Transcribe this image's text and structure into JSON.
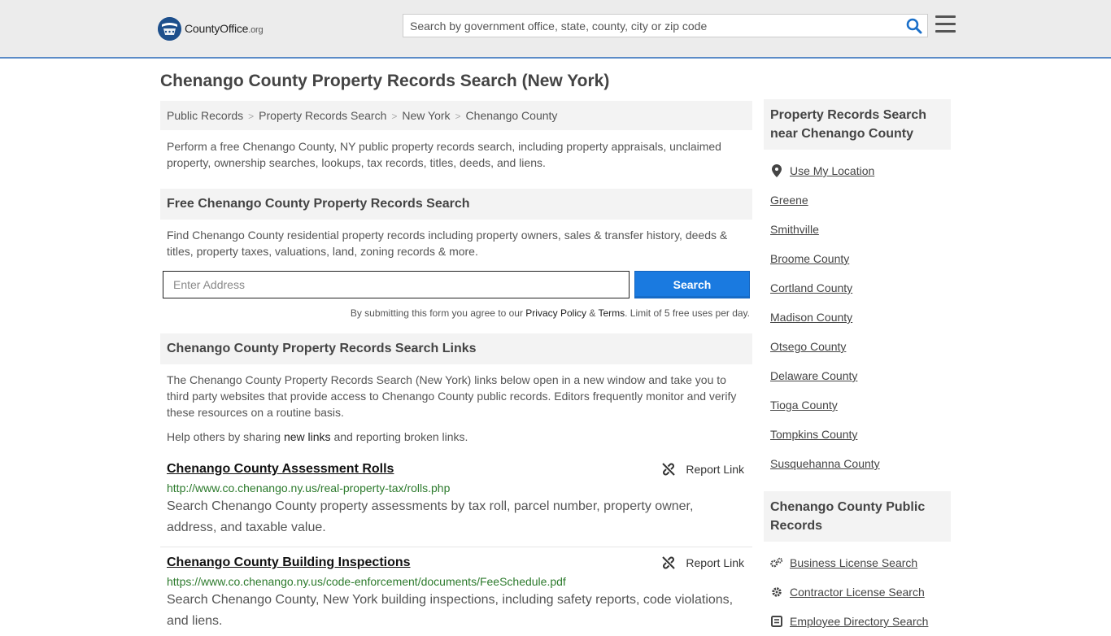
{
  "header": {
    "logo_main": "CountyOffice",
    "logo_org": ".org",
    "search_placeholder": "Search by government office, state, county, city or zip code"
  },
  "page_title": "Chenango County Property Records Search (New York)",
  "breadcrumbs": [
    "Public Records",
    "Property Records Search",
    "New York",
    "Chenango County"
  ],
  "intro": "Perform a free Chenango County, NY public property records search, including property appraisals, unclaimed property, ownership searches, lookups, tax records, titles, deeds, and liens.",
  "free_search": {
    "heading": "Free Chenango County Property Records Search",
    "text": "Find Chenango County residential property records including property owners, sales & transfer history, deeds & titles, property taxes, valuations, land, zoning records & more.",
    "address_placeholder": "Enter Address",
    "button": "Search",
    "disclaimer_prefix": "By submitting this form you agree to our",
    "privacy": "Privacy Policy",
    "amp": "&",
    "terms": "Terms",
    "disclaimer_suffix": ". Limit of 5 free uses per day."
  },
  "links_section": {
    "heading": "Chenango County Property Records Search Links",
    "text": "The Chenango County Property Records Search (New York) links below open in a new window and take you to third party websites that provide access to Chenango County public records. Editors frequently monitor and verify these resources on a routine basis.",
    "help_prefix": "Help others by sharing",
    "help_link": "new links",
    "help_suffix": "and reporting broken links.",
    "report_label": "Report Link",
    "items": [
      {
        "title": "Chenango County Assessment Rolls",
        "url": "http://www.co.chenango.ny.us/real-property-tax/rolls.php",
        "desc": "Search Chenango County property assessments by tax roll, parcel number, property owner, address, and taxable value."
      },
      {
        "title": "Chenango County Building Inspections",
        "url": "https://www.co.chenango.ny.us/code-enforcement/documents/FeeSchedule.pdf",
        "desc": "Search Chenango County, New York building inspections, including safety reports, code violations, and liens."
      }
    ]
  },
  "sidebar": {
    "nearby_heading": "Property Records Search near Chenango County",
    "use_location": "Use My Location",
    "nearby": [
      "Greene",
      "Smithville",
      "Broome County",
      "Cortland County",
      "Madison County",
      "Otsego County",
      "Delaware County",
      "Tioga County",
      "Tompkins County",
      "Susquehanna County"
    ],
    "public_heading": "Chenango County Public Records",
    "public_links": [
      "Business License Search",
      "Contractor License Search",
      "Employee Directory Search"
    ]
  }
}
